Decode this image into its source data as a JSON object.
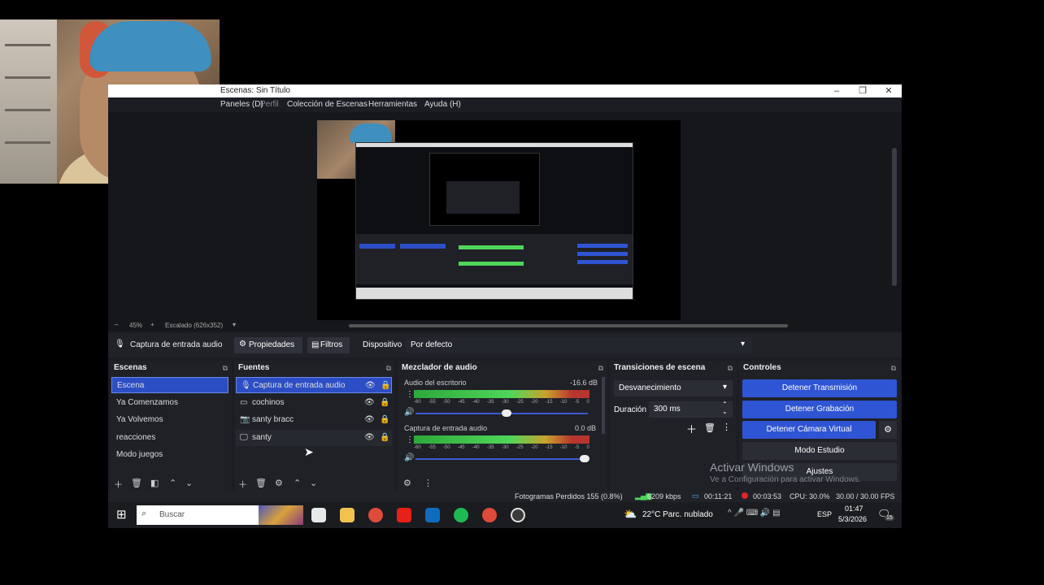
{
  "window": {
    "title": "Escenas: Sin Título"
  },
  "menu": [
    "Paneles (D)",
    "Perfil",
    "Colección de Escenas",
    "Herramientas",
    "Ayuda (H)"
  ],
  "zoom": {
    "minus": "–",
    "value": "45%",
    "plus": "+",
    "scale_label": "Escalado (626x352)"
  },
  "source_toolbar": {
    "source_name": "Captura de entrada audio",
    "properties": "Propiedades",
    "filters": "Filtros",
    "device_label": "Dispositivo",
    "device_value": "Por defecto"
  },
  "scenes": {
    "title": "Escenas",
    "items": [
      "Escena",
      "Ya Comenzamos",
      "Ya Volvemos",
      "reacciones",
      "Modo juegos"
    ]
  },
  "sources": {
    "title": "Fuentes",
    "items": [
      "Captura de entrada audio",
      "cochinos",
      "santy bracc",
      "santy"
    ]
  },
  "mixer": {
    "title": "Mezclador de audio",
    "channels": [
      {
        "name": "Audio del escritorio",
        "db": "-16.6 dB"
      },
      {
        "name": "Captura de entrada audio",
        "db": "0.0 dB"
      }
    ],
    "scale": [
      "-60",
      "-55",
      "-50",
      "-45",
      "-40",
      "-35",
      "-30",
      "-25",
      "-20",
      "-15",
      "-10",
      "-5",
      "0"
    ]
  },
  "transitions": {
    "title": "Transiciones de escena",
    "selected": "Desvanecimiento",
    "duration_label": "Duración",
    "duration_value": "300 ms"
  },
  "controls": {
    "title": "Controles",
    "stop_stream": "Detener Transmisión",
    "stop_record": "Detener Grabación",
    "stop_virtual_cam": "Detener Cámara Virtual",
    "studio_mode": "Modo Estudio",
    "settings": "Ajustes"
  },
  "status": {
    "dropped": "Fotogramas Perdidos 155 (0.8%)",
    "kbps": "6209 kbps",
    "stream_time": "00:11:21",
    "rec_time": "00:03:53",
    "cpu": "CPU: 30.0%",
    "fps": "30.00 / 30.00 FPS"
  },
  "taskbar": {
    "search_placeholder": "Buscar",
    "weather": "22°C  Parc. nublado",
    "lang": "ESP",
    "time": "01:47",
    "date": "5/3/2026",
    "notif_count": "15"
  },
  "watermark": {
    "line1": "Activar Windows",
    "line2": "Ve a Configuración para activar Windows."
  }
}
